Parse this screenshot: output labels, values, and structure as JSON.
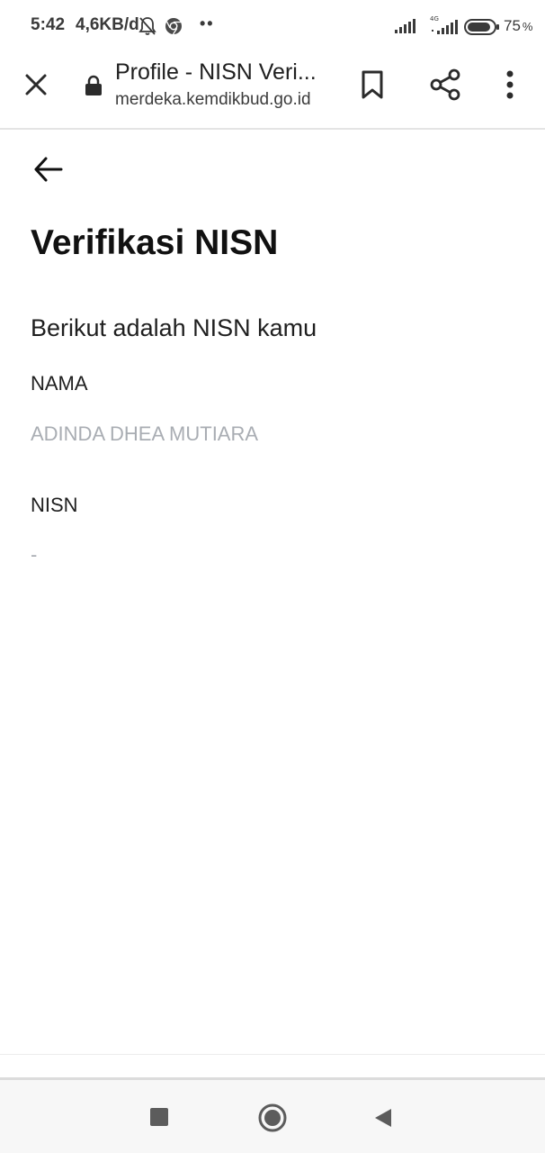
{
  "status_bar": {
    "time": "5:42",
    "net_speed": "4,6KB/d",
    "dots": "••",
    "battery_level": "75",
    "battery_unit": "%",
    "network_type": "4G",
    "icons": [
      "bell-off-icon",
      "chrome-icon",
      "signal-icon",
      "signal-4g-icon",
      "battery-icon"
    ]
  },
  "browser": {
    "title": "Profile - NISN Veri...",
    "url": "merdeka.kemdikbud.go.id",
    "icons": [
      "close-icon",
      "lock-icon",
      "bookmark-icon",
      "share-icon",
      "more-vert-icon"
    ]
  },
  "page": {
    "back_icon": "arrow-left-icon",
    "title": "Verifikasi NISN",
    "intro": "Berikut adalah NISN kamu",
    "fields": [
      {
        "label": "NAMA",
        "value": "ADINDA DHEA MUTIARA"
      },
      {
        "label": "NISN",
        "value": "-"
      }
    ]
  },
  "nav_bar": {
    "icons": [
      "recents-square-icon",
      "home-circle-icon",
      "back-triangle-icon"
    ]
  },
  "colors": {
    "value_text": "#a9adb3",
    "title_text": "#111111"
  }
}
